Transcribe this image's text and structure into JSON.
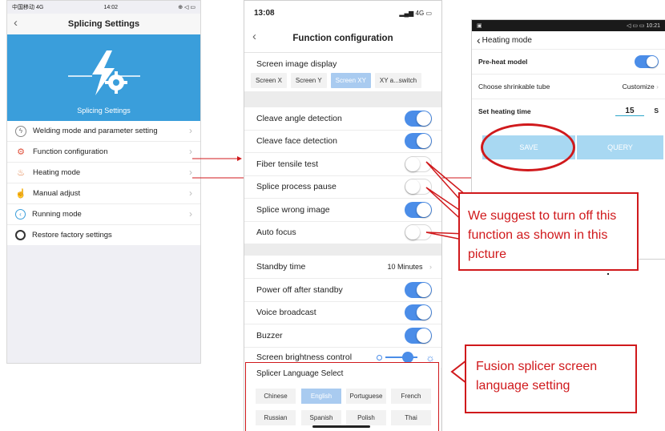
{
  "left_phone": {
    "status": {
      "carrier": "中国移动 4G",
      "time": "14:02"
    },
    "title": "Splicing Settings",
    "banner_label": "Splicing Settings",
    "menu": [
      {
        "label": "Welding mode and parameter setting",
        "icon": "lightning-icon"
      },
      {
        "label": "Function configuration",
        "icon": "gear-icon"
      },
      {
        "label": "Heating mode",
        "icon": "heating-icon"
      },
      {
        "label": "Manual adjust",
        "icon": "hand-icon"
      },
      {
        "label": "Running mode",
        "icon": "running-icon"
      },
      {
        "label": "Restore factory settings",
        "icon": "restore-icon"
      }
    ]
  },
  "mid_phone": {
    "status": {
      "time": "13:08",
      "network": "4G"
    },
    "title": "Function configuration",
    "screen_image_display": {
      "label": "Screen image display",
      "options": [
        "Screen X",
        "Screen Y",
        "Screen XY",
        "XY a...switch"
      ],
      "selected": "Screen XY"
    },
    "rows1": [
      {
        "label": "Cleave angle detection",
        "state": "on"
      },
      {
        "label": "Cleave face detection",
        "state": "on"
      },
      {
        "label": "Fiber tensile test",
        "state": "off"
      },
      {
        "label": "Splice process pause",
        "state": "off"
      },
      {
        "label": "Splice wrong image",
        "state": "on"
      },
      {
        "label": "Auto focus",
        "state": "off"
      }
    ],
    "standby": {
      "label": "Standby time",
      "value": "10 Minutes"
    },
    "rows2": [
      {
        "label": "Power off after standby",
        "state": "on"
      },
      {
        "label": "Voice broadcast",
        "state": "on"
      },
      {
        "label": "Buzzer",
        "state": "on"
      }
    ],
    "brightness": {
      "label": "Screen brightness control",
      "level": 0.7
    },
    "language": {
      "title": "Splicer Language Select",
      "options": [
        "Chinese",
        "English",
        "Portuguese",
        "French",
        "Russian",
        "Spanish",
        "Polish",
        "Thai"
      ],
      "selected": "English"
    }
  },
  "right_phone": {
    "status": {
      "time": "10:21"
    },
    "title": "Heating mode",
    "preheat_label": "Pre-heat model",
    "preheat_state": "on",
    "tube_label": "Choose shrinkable tube",
    "tube_value": "Customize",
    "heating_time_label": "Set heating time",
    "heating_time_value": "15",
    "heating_time_unit": "S",
    "save_label": "SAVE",
    "query_label": "QUERY"
  },
  "annotations": {
    "suggestion": "We suggest to turn off this function as shown in this picture",
    "language": "Fusion splicer screen language setting"
  },
  "colors": {
    "accent": "#4b8de8",
    "banner": "#3a9edb",
    "annotation": "#d0191c",
    "selected_segment": "#a9cbf0"
  }
}
